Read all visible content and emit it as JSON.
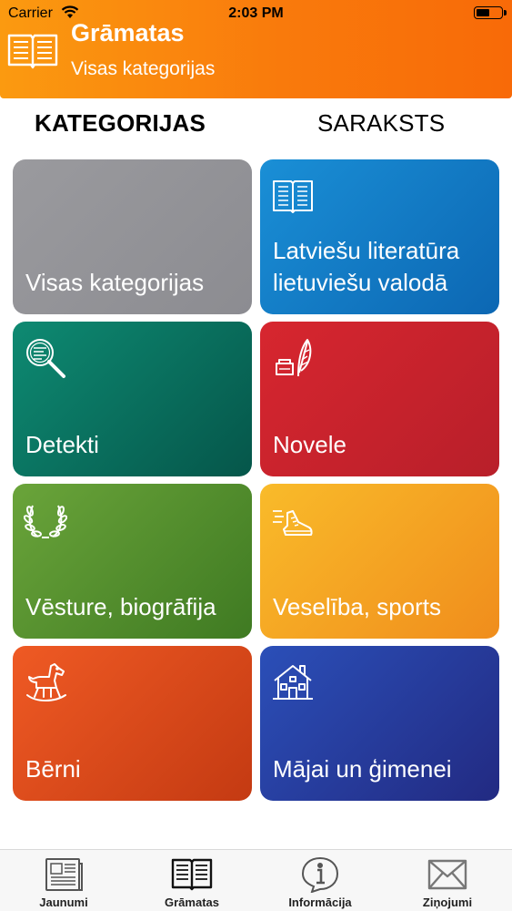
{
  "status": {
    "carrier": "Carrier",
    "time": "2:03 PM",
    "battery_level": 0.55
  },
  "header": {
    "title": "Grāmatas",
    "subtitle": "Visas kategorijas",
    "icon": "open-book-icon",
    "color": "#f98a0e"
  },
  "tabs": {
    "active": "KATEGORIJAS",
    "inactive": "SARAKSTS"
  },
  "tiles": [
    {
      "label": "Visas kategorijas",
      "icon": "",
      "color": "#8e8e93"
    },
    {
      "label": "Latviešu literatūra lietuviešu valodā",
      "icon": "book-icon",
      "color": "#0c6fbf"
    },
    {
      "label": "Detekti",
      "icon": "magnifier-icon",
      "color": "#05604f"
    },
    {
      "label": "Novele",
      "icon": "ink-feather-icon",
      "color": "#c5202b"
    },
    {
      "label": "Vēsture, biogrāfija",
      "icon": "laurel-icon",
      "color": "#4b8a2a"
    },
    {
      "label": "Veselība, sports",
      "icon": "running-shoe-icon",
      "color": "#f4a122"
    },
    {
      "label": "Bērni",
      "icon": "rocking-horse-icon",
      "color": "#d94a1a"
    },
    {
      "label": "Mājai un ģimenei",
      "icon": "house-icon",
      "color": "#26349a"
    }
  ],
  "tabbar": [
    {
      "label": "Jaunumi",
      "icon": "newspaper-icon"
    },
    {
      "label": "Grāmatas",
      "icon": "book-icon"
    },
    {
      "label": "Informācija",
      "icon": "info-bubble-icon"
    },
    {
      "label": "Ziņojumi",
      "icon": "envelope-icon"
    }
  ]
}
